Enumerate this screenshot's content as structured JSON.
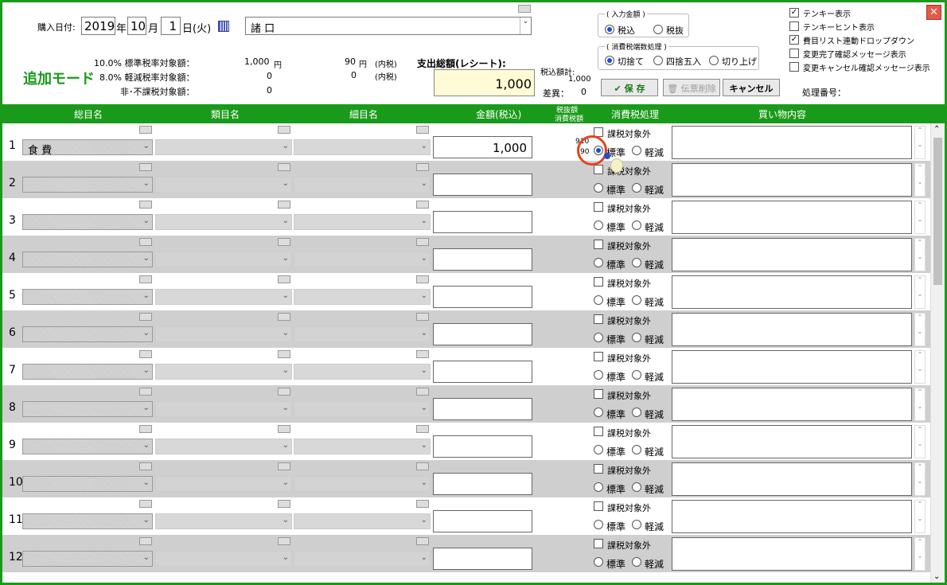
{
  "header": {
    "purchase_date_label": "購入日付:",
    "year": "2019",
    "year_unit": "年",
    "month": "10",
    "month_unit": "月",
    "day": "1",
    "day_unit": "日",
    "weekday": "(火)",
    "store": "諸 口",
    "mode_label": "追加モード",
    "std_rate_label": "10.0% 標準税率対象額：",
    "std_amount": "1,000",
    "yen": "円",
    "std_tax": "90",
    "std_tax_note": "円　(内税)",
    "red_rate_label": "8.0% 軽減税率対象額：",
    "red_amount": "0",
    "red_tax": "0",
    "red_tax_note": "(内税)",
    "nontax_label": "非･不課税対象額：",
    "nontax_amount": "0",
    "total_label": "支出総額(レシート):",
    "total_value": "1,000",
    "incl_total_label": "税込額計:",
    "incl_total_value": "1,000",
    "diff_label": "差異：",
    "diff_value": "0",
    "input_group_title": "( 入力金額 )",
    "input_incl": "税込",
    "input_excl": "税抜",
    "rounding_group_title": "( 消費税端数処理 )",
    "round_down": "切捨て",
    "round_half": "四捨五入",
    "round_up": "切り上げ",
    "save_label": "保 存",
    "delete_label": "伝票削除",
    "cancel_label": "キャンセル",
    "proc_no_label": "処理番号：",
    "options": [
      {
        "label": "テンキー表示",
        "checked": true
      },
      {
        "label": "テンキーヒント表示",
        "checked": false
      },
      {
        "label": "費目リスト連動ドロップダウン",
        "checked": true
      },
      {
        "label": "変更完了確認メッセージ表示",
        "checked": false
      },
      {
        "label": "変更キャンセル確認メッセージ表示",
        "checked": false
      }
    ]
  },
  "columns": {
    "general": "総目名",
    "category": "類目名",
    "detail": "細目名",
    "amount": "金額(税込)",
    "excl_header_1": "税抜額",
    "excl_header_2": "消費税額",
    "tax_proc": "消費税処理",
    "memo": "買い物内容"
  },
  "row_labels": {
    "nontax": "課税対象外",
    "standard": "標準",
    "reduced": "軽減"
  },
  "rows": [
    {
      "num": "1",
      "general": "食 費",
      "amount": "1,000",
      "excl": "910",
      "tax": "90",
      "standard": true
    },
    {
      "num": "2",
      "general": "",
      "amount": ""
    },
    {
      "num": "3",
      "general": "",
      "amount": ""
    },
    {
      "num": "4",
      "general": "",
      "amount": ""
    },
    {
      "num": "5",
      "general": "",
      "amount": ""
    },
    {
      "num": "6",
      "general": "",
      "amount": ""
    },
    {
      "num": "7",
      "general": "",
      "amount": ""
    },
    {
      "num": "8",
      "general": "",
      "amount": ""
    },
    {
      "num": "9",
      "general": "",
      "amount": ""
    },
    {
      "num": "10",
      "general": "",
      "amount": ""
    },
    {
      "num": "11",
      "general": "",
      "amount": ""
    },
    {
      "num": "12",
      "general": "",
      "amount": ""
    }
  ],
  "colors": {
    "accent_green": "#1a9a1a",
    "highlight_circle": "#e8401c",
    "total_bg": "#fefbd6"
  }
}
